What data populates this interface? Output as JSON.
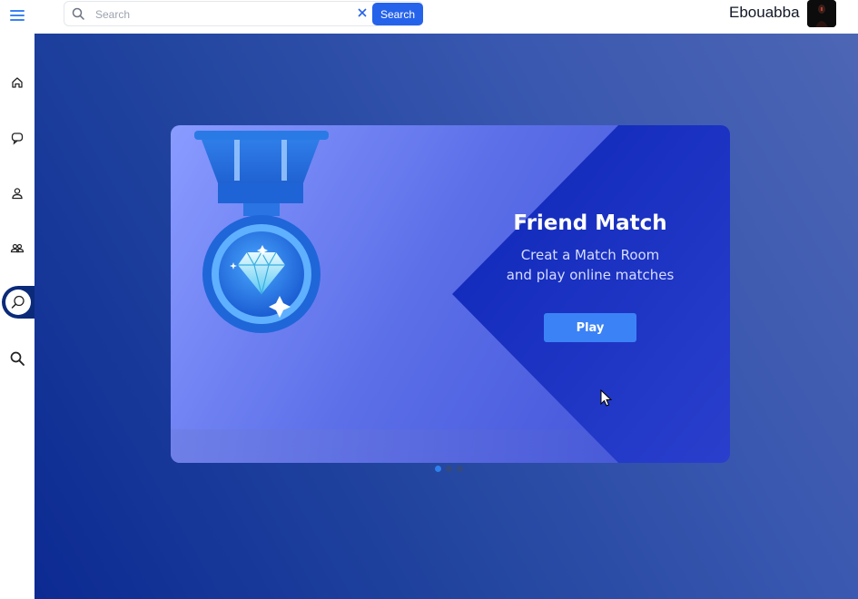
{
  "header": {
    "search": {
      "placeholder": "Search",
      "button_label": "Search"
    },
    "user": {
      "name": "Ebouabba"
    }
  },
  "sidebar": {
    "items": [
      {
        "icon": "home-icon"
      },
      {
        "icon": "chat-icon"
      },
      {
        "icon": "user-icon"
      },
      {
        "icon": "friends-icon"
      },
      {
        "icon": "game-search-icon",
        "active": true
      },
      {
        "icon": "search-icon"
      }
    ]
  },
  "carousel": {
    "slide": {
      "title": "Friend Match",
      "subtitle_line1": "Creat a Match Room",
      "subtitle_line2": "and play online matches",
      "button_label": "Play"
    },
    "slide_count": 3,
    "active_index": 0
  },
  "colors": {
    "accent": "#2563eb",
    "sidebar_active": "#0b2a7a",
    "play_button": "#3b82f6"
  }
}
